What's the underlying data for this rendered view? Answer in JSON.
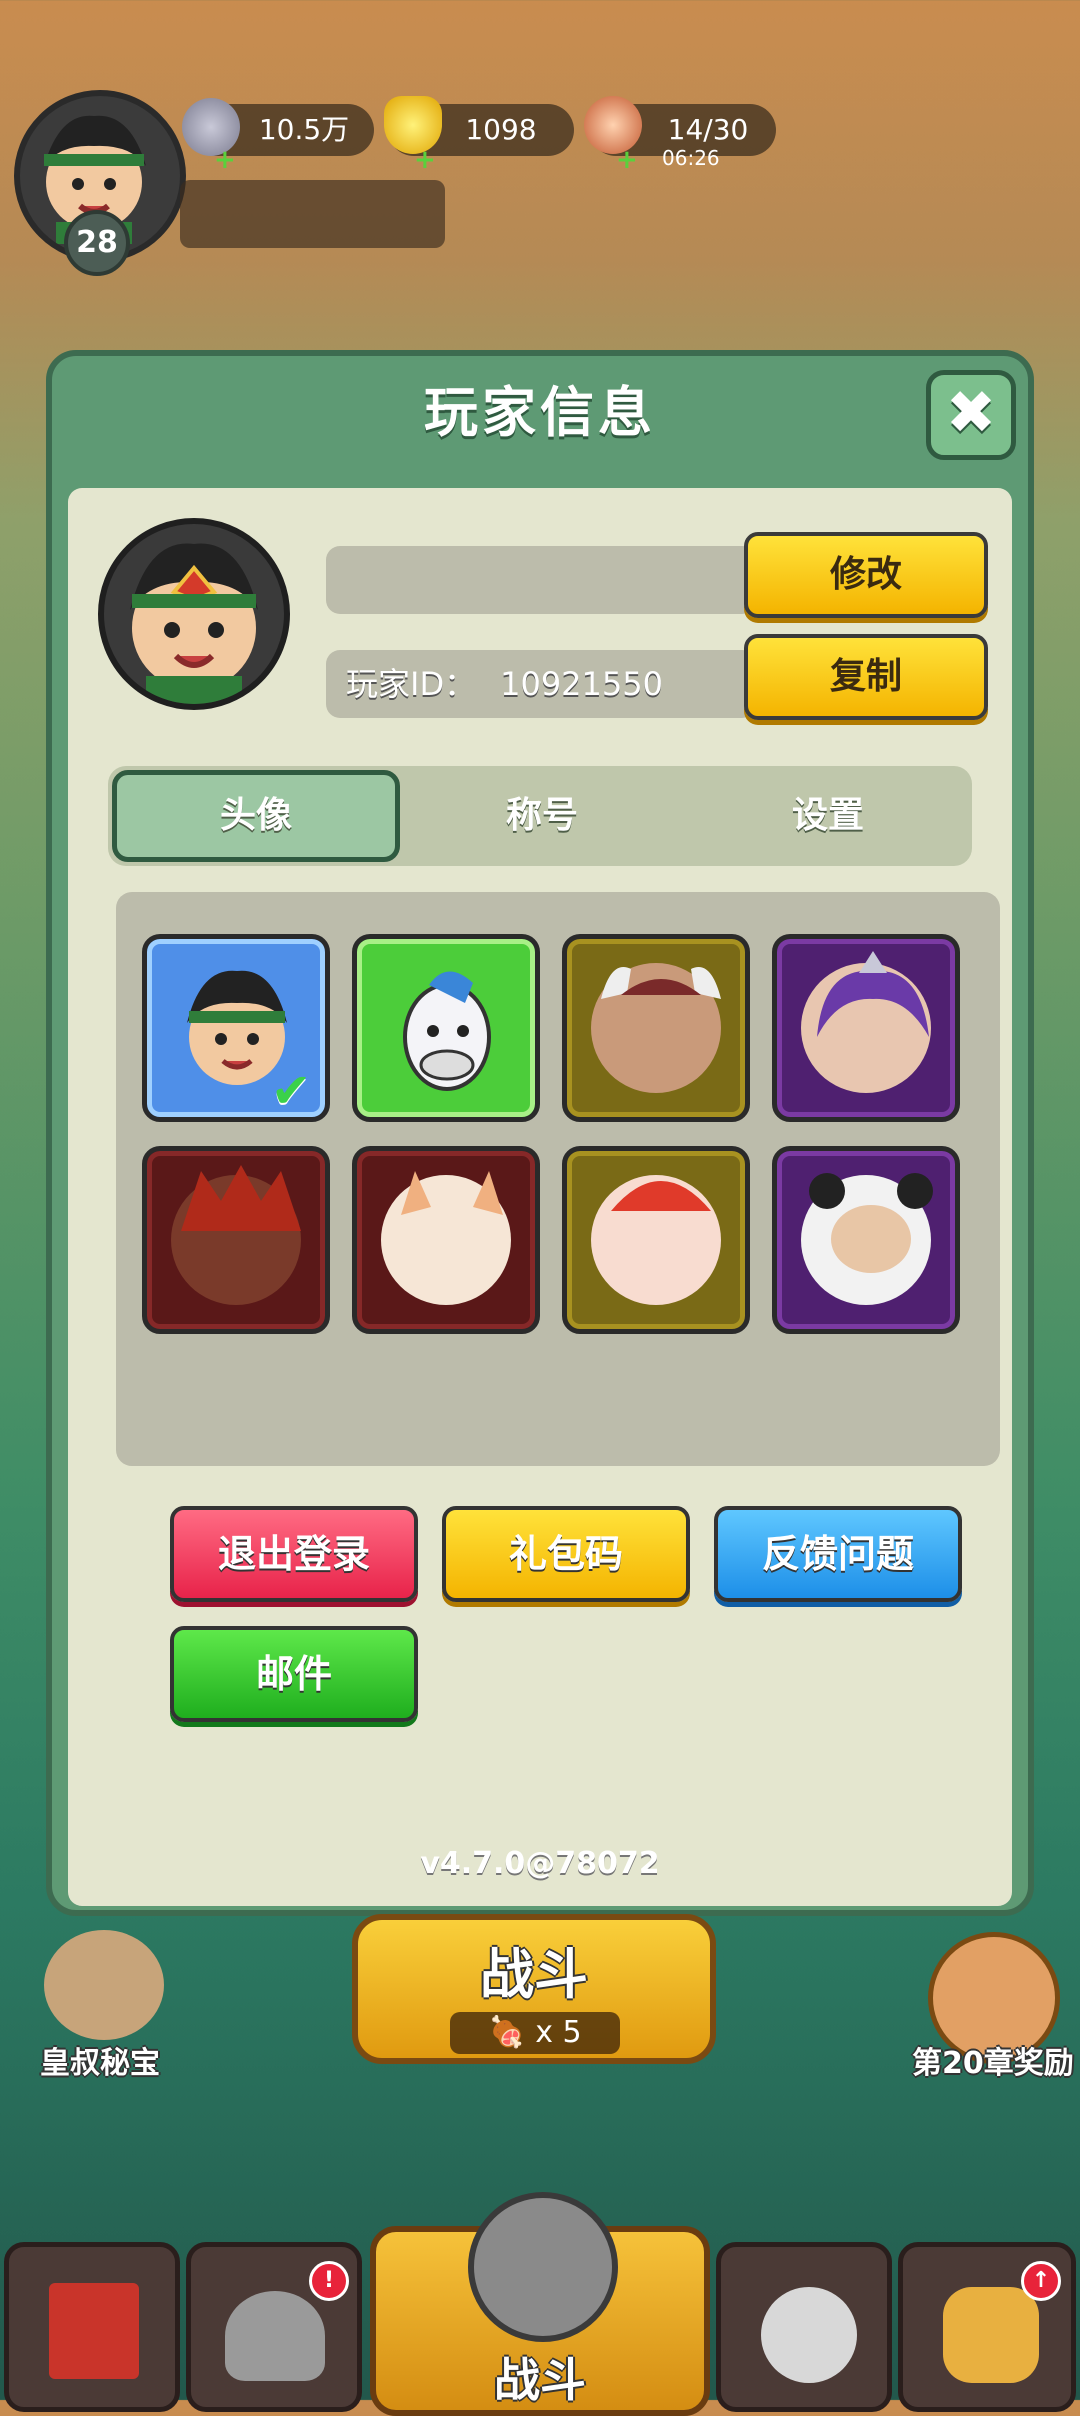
{
  "hud": {
    "level": "28",
    "coins": "10.5万",
    "gold": "1098",
    "stamina": "14/30",
    "stamina_timer": "06:26"
  },
  "dialog": {
    "title": "玩家信息",
    "player_id_label": "玩家ID：",
    "player_id": "10921550",
    "edit_label": "修改",
    "copy_label": "复制",
    "tabs": [
      "头像",
      "称号",
      "设置"
    ],
    "active_tab": "头像",
    "actions": {
      "logout": "退出登录",
      "gift_code": "礼包码",
      "feedback": "反馈问题",
      "mail": "邮件"
    },
    "version": "v4.7.0@78072"
  },
  "avatars": [
    {
      "name": "hero-avatar",
      "frame": "blue",
      "selected": true
    },
    {
      "name": "horse-avatar",
      "frame": "green"
    },
    {
      "name": "horned-warrior-avatar",
      "frame": "gold"
    },
    {
      "name": "purple-haired-avatar",
      "frame": "purple"
    },
    {
      "name": "masked-warrior-avatar",
      "frame": "red"
    },
    {
      "name": "lucky-cat-avatar",
      "frame": "red"
    },
    {
      "name": "lion-dance-avatar",
      "frame": "gold"
    },
    {
      "name": "panda-hood-avatar",
      "frame": "purple"
    }
  ],
  "bottom": {
    "battle_label": "战斗",
    "battle_cost": "x 5",
    "treasure_label": "皇叔秘宝",
    "chapter_reward_label": "第20章奖励",
    "nav_battle_label": "战斗"
  },
  "colors": {
    "dialog_frame": "#5e9a74",
    "dialog_content": "#e4e6cf",
    "accent_yellow": "#f4b400"
  }
}
